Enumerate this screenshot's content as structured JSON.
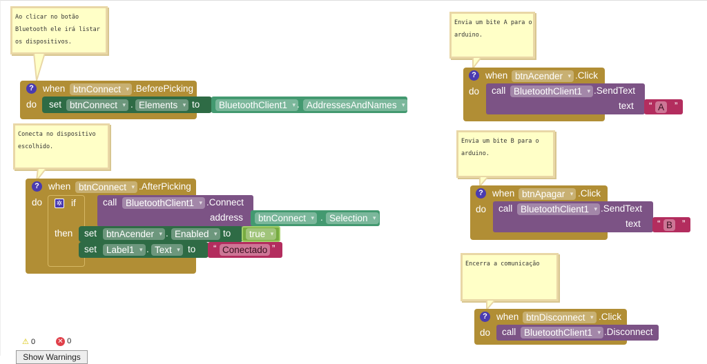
{
  "comments": [
    "Ao clicar no botão\nBluetooth ele irá listar\nos dispositivos.",
    "Conecta no dispositivo\nescolhido.",
    "Envia um bite A para o\narduino.",
    "Envia um bite B para o\narduino.",
    "Encerra a comunicação"
  ],
  "kw": {
    "when": "when",
    "do": "do",
    "set": "set",
    "to": "to",
    "call": "call",
    "if": "if",
    "then": "then",
    "address": "address",
    "text": "text",
    "dot": ".",
    "q": "?"
  },
  "b1": {
    "comp": "btnConnect",
    "event": ".BeforePicking",
    "setComp": "btnConnect",
    "prop": "Elements",
    "getComp": "BluetoothClient1",
    "getProp": "AddressesAndNames"
  },
  "b2": {
    "comp": "btnConnect",
    "event": ".AfterPicking",
    "callComp": "BluetoothClient1",
    "method": ".Connect",
    "getComp": "btnConnect",
    "getProp": "Selection",
    "set1Comp": "btnAcender",
    "set1Prop": "Enabled",
    "bool": "true",
    "set2Comp": "Label1",
    "set2Prop": "Text",
    "str": "Conectado"
  },
  "b3": {
    "comp": "btnAcender",
    "event": ".Click",
    "callComp": "BluetoothClient1",
    "method": ".SendText",
    "str": "A"
  },
  "b4": {
    "comp": "btnApagar",
    "event": ".Click",
    "callComp": "BluetoothClient1",
    "method": ".SendText",
    "str": "B"
  },
  "b5": {
    "comp": "btnDisconnect",
    "event": ".Click",
    "callComp": "BluetoothClient1",
    "method": ".Disconnect"
  },
  "status": {
    "warnings": "0",
    "errors": "0",
    "button": "Show Warnings"
  }
}
